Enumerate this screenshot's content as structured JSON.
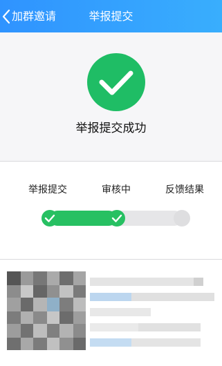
{
  "header": {
    "back_label": "加群邀请",
    "title": "举报提交"
  },
  "success": {
    "message": "举报提交成功",
    "color": "#1fbd65"
  },
  "progress": {
    "steps": [
      {
        "label": "举报提交",
        "status": "done"
      },
      {
        "label": "审核中",
        "status": "done"
      },
      {
        "label": "反馈结果",
        "status": "pending"
      }
    ],
    "completed_fraction": 0.5,
    "active_color": "#27c062",
    "inactive_color": "#e6e6e8"
  },
  "header_gradient": [
    "#2f93ff",
    "#39aefd"
  ]
}
